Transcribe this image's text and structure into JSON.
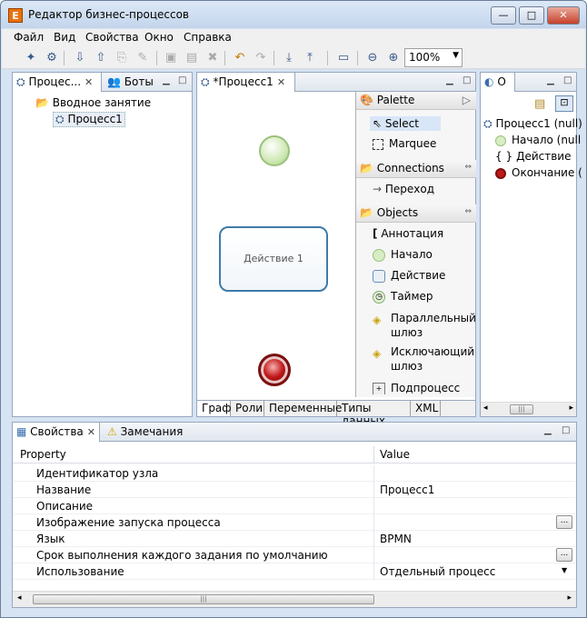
{
  "window": {
    "title": "Редактор бизнес-процессов",
    "app_icon": "E",
    "minimize": "—",
    "maximize": "□",
    "close": "✕"
  },
  "menu": [
    "Файл",
    "Вид",
    "Свойства",
    "Окно",
    "Справка"
  ],
  "toolbar": {
    "zoom": "100%"
  },
  "left_panel": {
    "tabs": [
      "Процес...",
      "Боты"
    ],
    "tree_root": "Вводное занятие",
    "tree_child": "Процесс1"
  },
  "editor": {
    "tab": "*Процесс1",
    "task_label": "Действие 1",
    "bottom_tabs": [
      "Граф",
      "Роли",
      "Переменные",
      "Типы данных",
      "XML"
    ]
  },
  "palette": {
    "header": "Palette",
    "select": "Select",
    "marquee": "Marquee",
    "connections": "Connections",
    "transition": "Переход",
    "objects": "Objects",
    "items": [
      "Аннотация",
      "Начало",
      "Действие",
      "Таймер",
      "Параллельный шлюз",
      "Исключающий шлюз",
      "Подпроцесс"
    ]
  },
  "outline": {
    "tab": "O",
    "root": "Процесс1 (null)",
    "items": [
      "Начало (null",
      "Действие",
      "Окончание ("
    ]
  },
  "properties": {
    "tabs": [
      "Свойства",
      "Замечания"
    ],
    "headers": {
      "property": "Property",
      "value": "Value"
    },
    "rows": [
      {
        "key": "Идентификатор узла",
        "value": ""
      },
      {
        "key": "Название",
        "value": "Процесс1"
      },
      {
        "key": "Описание",
        "value": ""
      },
      {
        "key": "Изображение запуска процесса",
        "value": ""
      },
      {
        "key": "Язык",
        "value": "BPMN"
      },
      {
        "key": "Срок выполнения каждого задания по умолчанию",
        "value": ""
      },
      {
        "key": "Использование",
        "value": "Отдельный процесс"
      }
    ]
  }
}
